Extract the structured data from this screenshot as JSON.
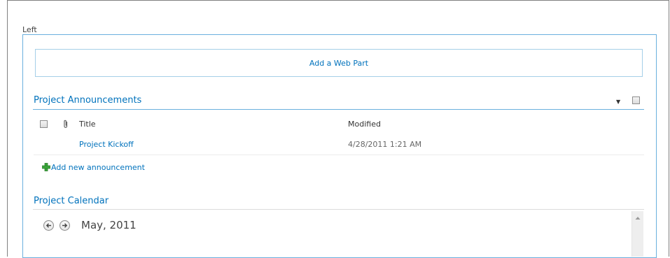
{
  "zone": {
    "label": "Left"
  },
  "add_web_part": {
    "label": "Add a Web Part"
  },
  "announcements": {
    "title": "Project Announcements",
    "columns": {
      "title": "Title",
      "modified": "Modified"
    },
    "rows": [
      {
        "title": "Project Kickoff",
        "modified": "4/28/2011 1:21 AM"
      }
    ],
    "add_new_label": "Add new announcement"
  },
  "calendar": {
    "title": "Project Calendar",
    "month_label": "May, 2011"
  },
  "icons": {
    "menu_arrow": "dropdown-arrow-icon",
    "select_checkbox": "checkbox-icon",
    "attachment": "paperclip-icon",
    "add": "green-plus-icon",
    "prev": "arrow-left-icon",
    "next": "arrow-right-icon",
    "scroll_up": "scroll-up-icon"
  },
  "colors": {
    "link": "#0072bc",
    "zone_border": "#6ab0de",
    "add_icon": "#3aa63a"
  }
}
